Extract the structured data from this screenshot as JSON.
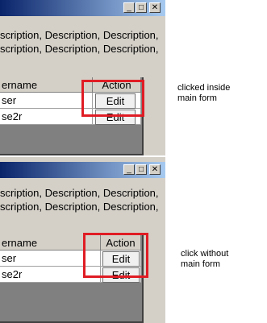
{
  "top": {
    "window_buttons": [
      "_",
      "□",
      "✕"
    ],
    "description_lines": [
      "scription, Description, Description,",
      "scription, Description, Description,"
    ],
    "grid": {
      "headers": [
        "ername",
        "Action"
      ],
      "rows": [
        {
          "name": "ser",
          "action": "Edit"
        },
        {
          "name": "se2r",
          "action": "Edit"
        }
      ]
    },
    "note": [
      "clicked inside",
      "main form"
    ]
  },
  "bottom": {
    "window_buttons": [
      "_",
      "□",
      "✕"
    ],
    "description_lines": [
      "scription, Description, Description,",
      "scription, Description, Description,"
    ],
    "grid": {
      "headers": [
        "ername",
        "Action"
      ],
      "rows": [
        {
          "name": "ser",
          "action": "Edit"
        },
        {
          "name": "se2r",
          "action": "Edit"
        }
      ]
    },
    "note": [
      "click without",
      "main form"
    ]
  },
  "colors": {
    "highlight": "#e01c24",
    "form_bg": "#d4d0c8",
    "grid_bg": "#808080"
  }
}
